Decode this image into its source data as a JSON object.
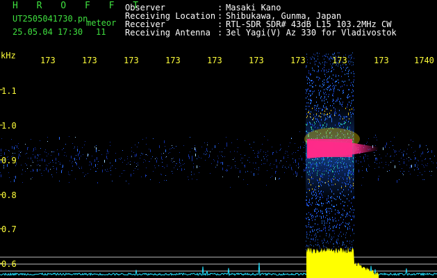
{
  "header": {
    "logo": "H R O F F T",
    "filename": "UT2505041730.pn",
    "tag": "meteor",
    "datetime": "25.05.04 17:30",
    "count": "11",
    "info": [
      {
        "label": "Observer",
        "value": "Masaki Kano"
      },
      {
        "label": "Receiving Location",
        "value": "Shibukawa, Gunma, Japan"
      },
      {
        "label": "Receiver",
        "value": "RTL-SDR SDR# 43dB L15 103.2MHz CW"
      },
      {
        "label": "Receiving Antenna",
        "value": "3el Yagi(V) Az 330 for Vladivostok"
      }
    ]
  },
  "axis": {
    "unit": "kHz",
    "y_ticks": [
      "1.1",
      "1.0",
      "0.9",
      "0.8",
      "0.7",
      "0.6"
    ],
    "x_ticks": [
      "173",
      "173",
      "173",
      "173",
      "173",
      "173",
      "173",
      "173",
      "173",
      "1740"
    ]
  },
  "colors": {
    "text_green": "#3fe13f",
    "text_white": "#ffffff",
    "text_yellow": "#ffff3a",
    "signal_core": "#ff2a8a",
    "signal_mid": "#ffe000",
    "signal_low": "#1f6bff",
    "baseline_cyan": "#22e0ff",
    "amplitude_yellow": "#ffff00"
  }
}
